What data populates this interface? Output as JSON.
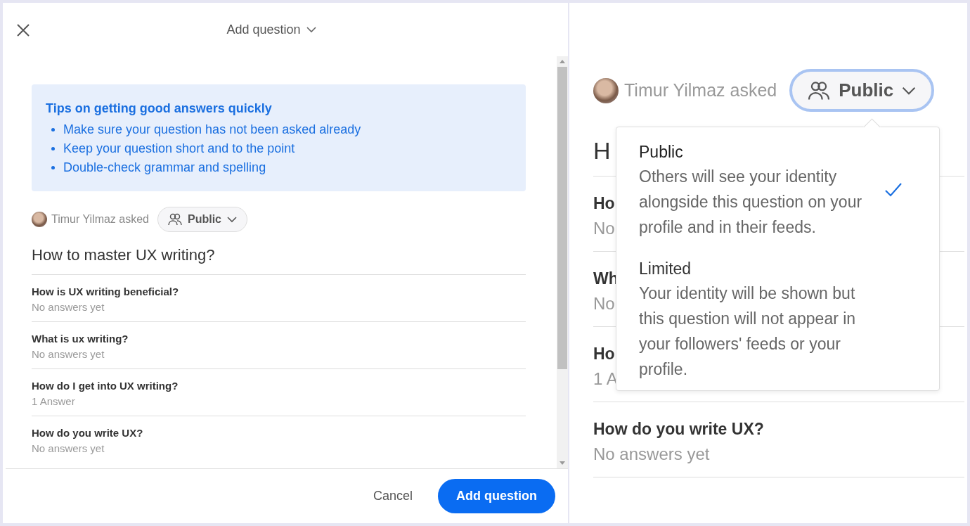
{
  "dialog": {
    "title": "Add question",
    "tips": {
      "heading": "Tips on getting good answers quickly",
      "items": [
        "Make sure your question has not been asked already",
        "Keep your question short and to the point",
        "Double-check grammar and spelling"
      ]
    },
    "author": "Timur Yilmaz asked",
    "privacy": "Public",
    "question": "How to master UX writing?",
    "related": [
      {
        "title": "How is UX writing beneficial?",
        "meta": "No answers yet"
      },
      {
        "title": "What is ux writing?",
        "meta": "No answers yet"
      },
      {
        "title": "How do I get into UX writing?",
        "meta": "1 Answer"
      },
      {
        "title": "How do you write UX?",
        "meta": "No answers yet"
      }
    ],
    "buttons": {
      "cancel": "Cancel",
      "submit": "Add question"
    }
  },
  "zoom_view": {
    "author": "Timur Yilmaz asked",
    "privacy": "Public",
    "question": "H",
    "related": [
      {
        "title": "Ho",
        "meta": "No"
      },
      {
        "title": "Wh",
        "meta": "No"
      },
      {
        "title": "Ho",
        "meta": "1 A"
      },
      {
        "title": "How do you write UX?",
        "meta": "No answers yet"
      }
    ],
    "menu": [
      {
        "label": "Public",
        "description": "Others will see your identity alongside this question on your profile and in their feeds.",
        "selected": true
      },
      {
        "label": "Limited",
        "description": "Your identity will be shown but this question will not appear in your followers' feeds or your profile.",
        "selected": false
      }
    ]
  }
}
